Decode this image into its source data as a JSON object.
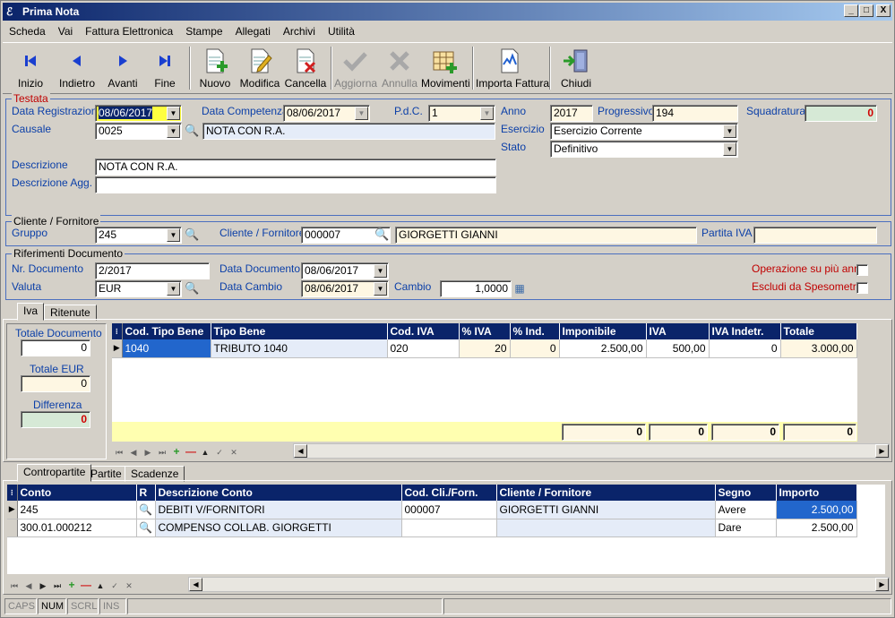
{
  "window": {
    "title": "Prima Nota",
    "min": "_",
    "max": "□",
    "close": "X"
  },
  "menu": [
    "Scheda",
    "Vai",
    "Fattura Elettronica",
    "Stampe",
    "Allegati",
    "Archivi",
    "Utilità"
  ],
  "toolbar": {
    "inizio": "Inizio",
    "indietro": "Indietro",
    "avanti": "Avanti",
    "fine": "Fine",
    "nuovo": "Nuovo",
    "modifica": "Modifica",
    "cancella": "Cancella",
    "aggiorna": "Aggiorna",
    "annulla": "Annulla",
    "movimenti": "Movimenti",
    "importa": "Importa Fattura",
    "chiudi": "Chiudi"
  },
  "testata": {
    "legend": "Testata",
    "data_reg_label": "Data Registrazione",
    "data_reg": "08/06/2017",
    "data_comp_label": "Data Competenza",
    "data_comp": "08/06/2017",
    "pdc_label": "P.d.C.",
    "pdc": "1",
    "anno_label": "Anno",
    "anno": "2017",
    "progressivo_label": "Progressivo",
    "progressivo": "194",
    "squadratura_label": "Squadratura",
    "squadratura": "0",
    "causale_label": "Causale",
    "causale_code": "0025",
    "causale_desc": "NOTA CON R.A.",
    "esercizio_label": "Esercizio",
    "esercizio": "Esercizio Corrente",
    "stato_label": "Stato",
    "stato": "Definitivo",
    "descrizione_label": "Descrizione",
    "descrizione": "NOTA CON R.A.",
    "descrizione_agg_label": "Descrizione Agg.",
    "descrizione_agg": ""
  },
  "cliente": {
    "legend": "Cliente / Fornitore",
    "gruppo_label": "Gruppo",
    "gruppo": "245",
    "cf_label": "Cliente / Fornitore",
    "cf_code": "000007",
    "cf_name": "GIORGETTI GIANNI",
    "piva_label": "Partita IVA",
    "piva": ""
  },
  "riferimenti": {
    "legend": "Riferimenti Documento",
    "nr_doc_label": "Nr. Documento",
    "nr_doc": "2/2017",
    "data_doc_label": "Data Documento",
    "data_doc": "08/06/2017",
    "valuta_label": "Valuta",
    "valuta": "EUR",
    "data_cambio_label": "Data Cambio",
    "data_cambio": "08/06/2017",
    "cambio_label": "Cambio",
    "cambio": "1,0000",
    "op_piu_anni_label": "Operazione su più anni",
    "escludi_label": "Escludi da Spesometro"
  },
  "tabs_iva": [
    "Iva",
    "Ritenute"
  ],
  "totali": {
    "totale_doc_label": "Totale Documento",
    "totale_doc": "0",
    "totale_eur_label": "Totale EUR",
    "totale_eur": "0",
    "differenza_label": "Differenza",
    "differenza": "0"
  },
  "iva_grid": {
    "headers": [
      "Cod. Tipo Bene",
      "Tipo Bene",
      "Cod. IVA",
      "% IVA",
      "% Ind.",
      "Imponibile",
      "IVA",
      "IVA Indetr.",
      "Totale"
    ],
    "rows": [
      [
        "1040",
        "TRIBUTO 1040",
        "020",
        "20",
        "0",
        "2.500,00",
        "500,00",
        "0",
        "3.000,00"
      ]
    ],
    "footer": [
      "0",
      "0",
      "0",
      "0"
    ]
  },
  "tabs_bottom": [
    "Contropartite",
    "Partite",
    "Scadenze"
  ],
  "contro_grid": {
    "headers": [
      "Conto",
      "R",
      "Descrizione Conto",
      "Cod. Cli./Forn.",
      "Cliente / Fornitore",
      "Segno",
      "Importo"
    ],
    "rows": [
      [
        "245",
        "",
        "DEBITI V/FORNITORI",
        "000007",
        "GIORGETTI GIANNI",
        "Avere",
        "2.500,00"
      ],
      [
        "300.01.000212",
        "",
        "COMPENSO COLLAB. GIORGETTI",
        "",
        "",
        "Dare",
        "2.500,00"
      ]
    ]
  },
  "status": [
    "CAPS",
    "NUM",
    "SCRL",
    "INS"
  ]
}
